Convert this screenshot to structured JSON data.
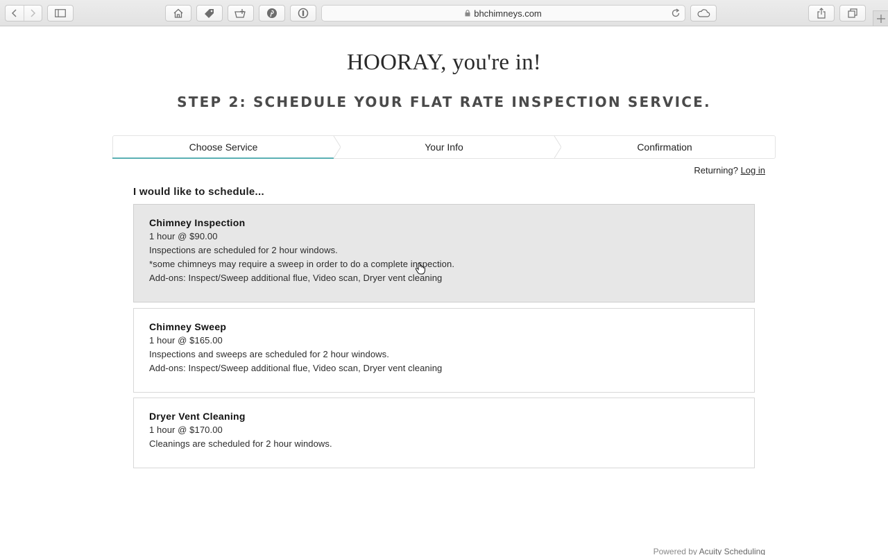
{
  "browser": {
    "url": "bhchimneys.com"
  },
  "page": {
    "title": "HOORAY, you're in!",
    "subtitle": "STEP 2: SCHEDULE YOUR FLAT RATE INSPECTION SERVICE."
  },
  "steps": [
    {
      "label": "Choose Service",
      "active": true
    },
    {
      "label": "Your Info",
      "active": false
    },
    {
      "label": "Confirmation",
      "active": false
    }
  ],
  "returning": {
    "prefix": "Returning?",
    "link": "Log in"
  },
  "schedule_label": "I would like to schedule...",
  "services": [
    {
      "name": "Chimney Inspection",
      "price": "1 hour @ $90.00",
      "lines": [
        "Inspections are scheduled for 2 hour windows.",
        "*some chimneys may require a sweep in order to do a complete inspection.",
        "Add-ons: Inspect/Sweep additional flue, Video scan, Dryer vent cleaning"
      ]
    },
    {
      "name": "Chimney Sweep",
      "price": "1 hour @ $165.00",
      "lines": [
        "Inspections and sweeps are scheduled for 2 hour windows.",
        "Add-ons: Inspect/Sweep additional flue, Video scan, Dryer vent cleaning"
      ]
    },
    {
      "name": "Dryer Vent Cleaning",
      "price": "1 hour @ $170.00",
      "lines": [
        "Cleanings are scheduled for 2 hour windows."
      ]
    }
  ],
  "footer": {
    "powered_prefix": "Powered by",
    "powered_brand": "Acuity Scheduling"
  },
  "colors": {
    "accent": "#5ab0b3",
    "hover_bg": "#e7e7e7"
  }
}
